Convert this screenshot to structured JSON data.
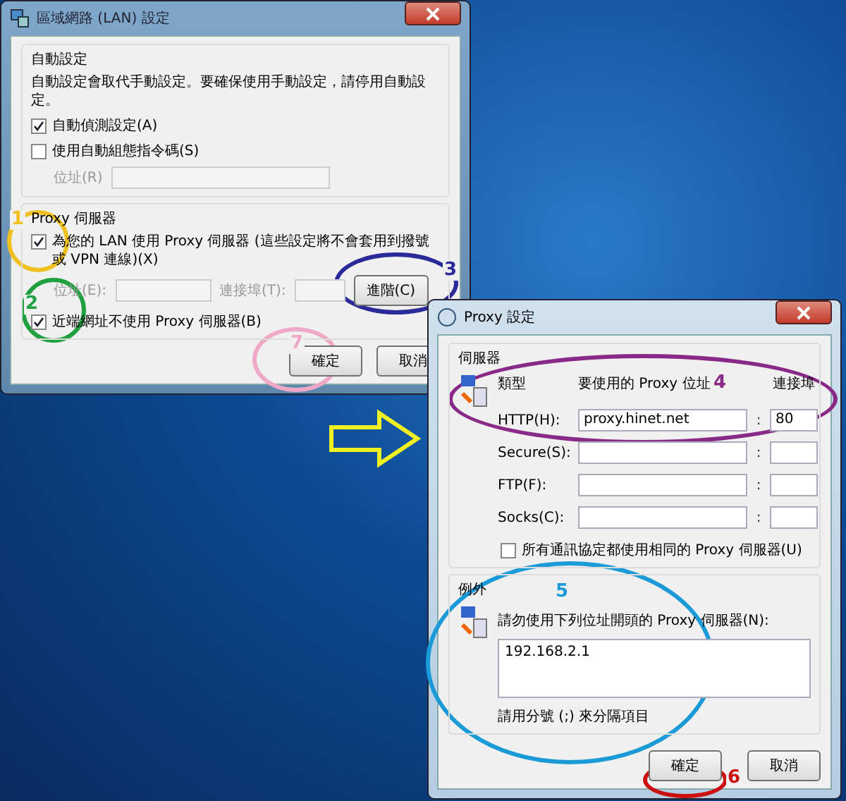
{
  "lan_dialog": {
    "title": "區域網路 (LAN) 設定",
    "auto_group": {
      "title": "自動設定",
      "description": "自動設定會取代手動設定。要確保使用手動設定，請停用自動設定。",
      "checkboxes": [
        {
          "label": "自動偵測設定(A)",
          "checked": true
        },
        {
          "label": "使用自動組態指令碼(S)",
          "checked": false
        }
      ],
      "address_label": "位址(R)"
    },
    "proxy_group": {
      "title": "Proxy 伺服器",
      "use_proxy": {
        "label": "為您的 LAN 使用 Proxy 伺服器 (這些設定將不會套用到撥號或 VPN 連線)(X)",
        "checked": true
      },
      "address_label": "位址(E):",
      "port_label": "連接埠(T):",
      "advanced_button": "進階(C)",
      "bypass_local": {
        "label": "近端網址不使用 Proxy 伺服器(B)",
        "checked": true
      }
    },
    "buttons": [
      "確定",
      "取消"
    ]
  },
  "proxy_dialog": {
    "title": "Proxy 設定",
    "servers_group": {
      "title": "伺服器",
      "columns": [
        "類型",
        "要使用的 Proxy 位址",
        "連接埠"
      ],
      "rows": [
        {
          "type": "HTTP(H):",
          "address": "proxy.hinet.net",
          "separator": ":",
          "port": "80"
        },
        {
          "type": "Secure(S):",
          "address": "",
          "separator": ":",
          "port": ""
        },
        {
          "type": "FTP(F):",
          "address": "",
          "separator": ":",
          "port": ""
        },
        {
          "type": "Socks(C):",
          "address": "",
          "separator": ":",
          "port": ""
        }
      ],
      "same_proxy": {
        "label": "所有通訊協定都使用相同的 Proxy 伺服器(U)",
        "checked": false
      }
    },
    "exceptions_group": {
      "title": "例外",
      "label": "請勿使用下列位址開頭的 Proxy 伺服器(N):",
      "value": "192.168.2.1",
      "hint": "請用分號 (;) 來分隔項目"
    },
    "buttons": [
      "確定",
      "取消"
    ]
  },
  "annotations": [
    {
      "number": "1",
      "color": "#f0c020"
    },
    {
      "number": "2",
      "color": "#20a040"
    },
    {
      "number": "3",
      "color": "#2a2a9a"
    },
    {
      "number": "7",
      "color": "#f0a8c8"
    },
    {
      "number": "4",
      "color": "#8a2a88"
    },
    {
      "number": "5",
      "color": "#1a9ad6"
    },
    {
      "number": "6",
      "color": "#cc1010"
    }
  ]
}
